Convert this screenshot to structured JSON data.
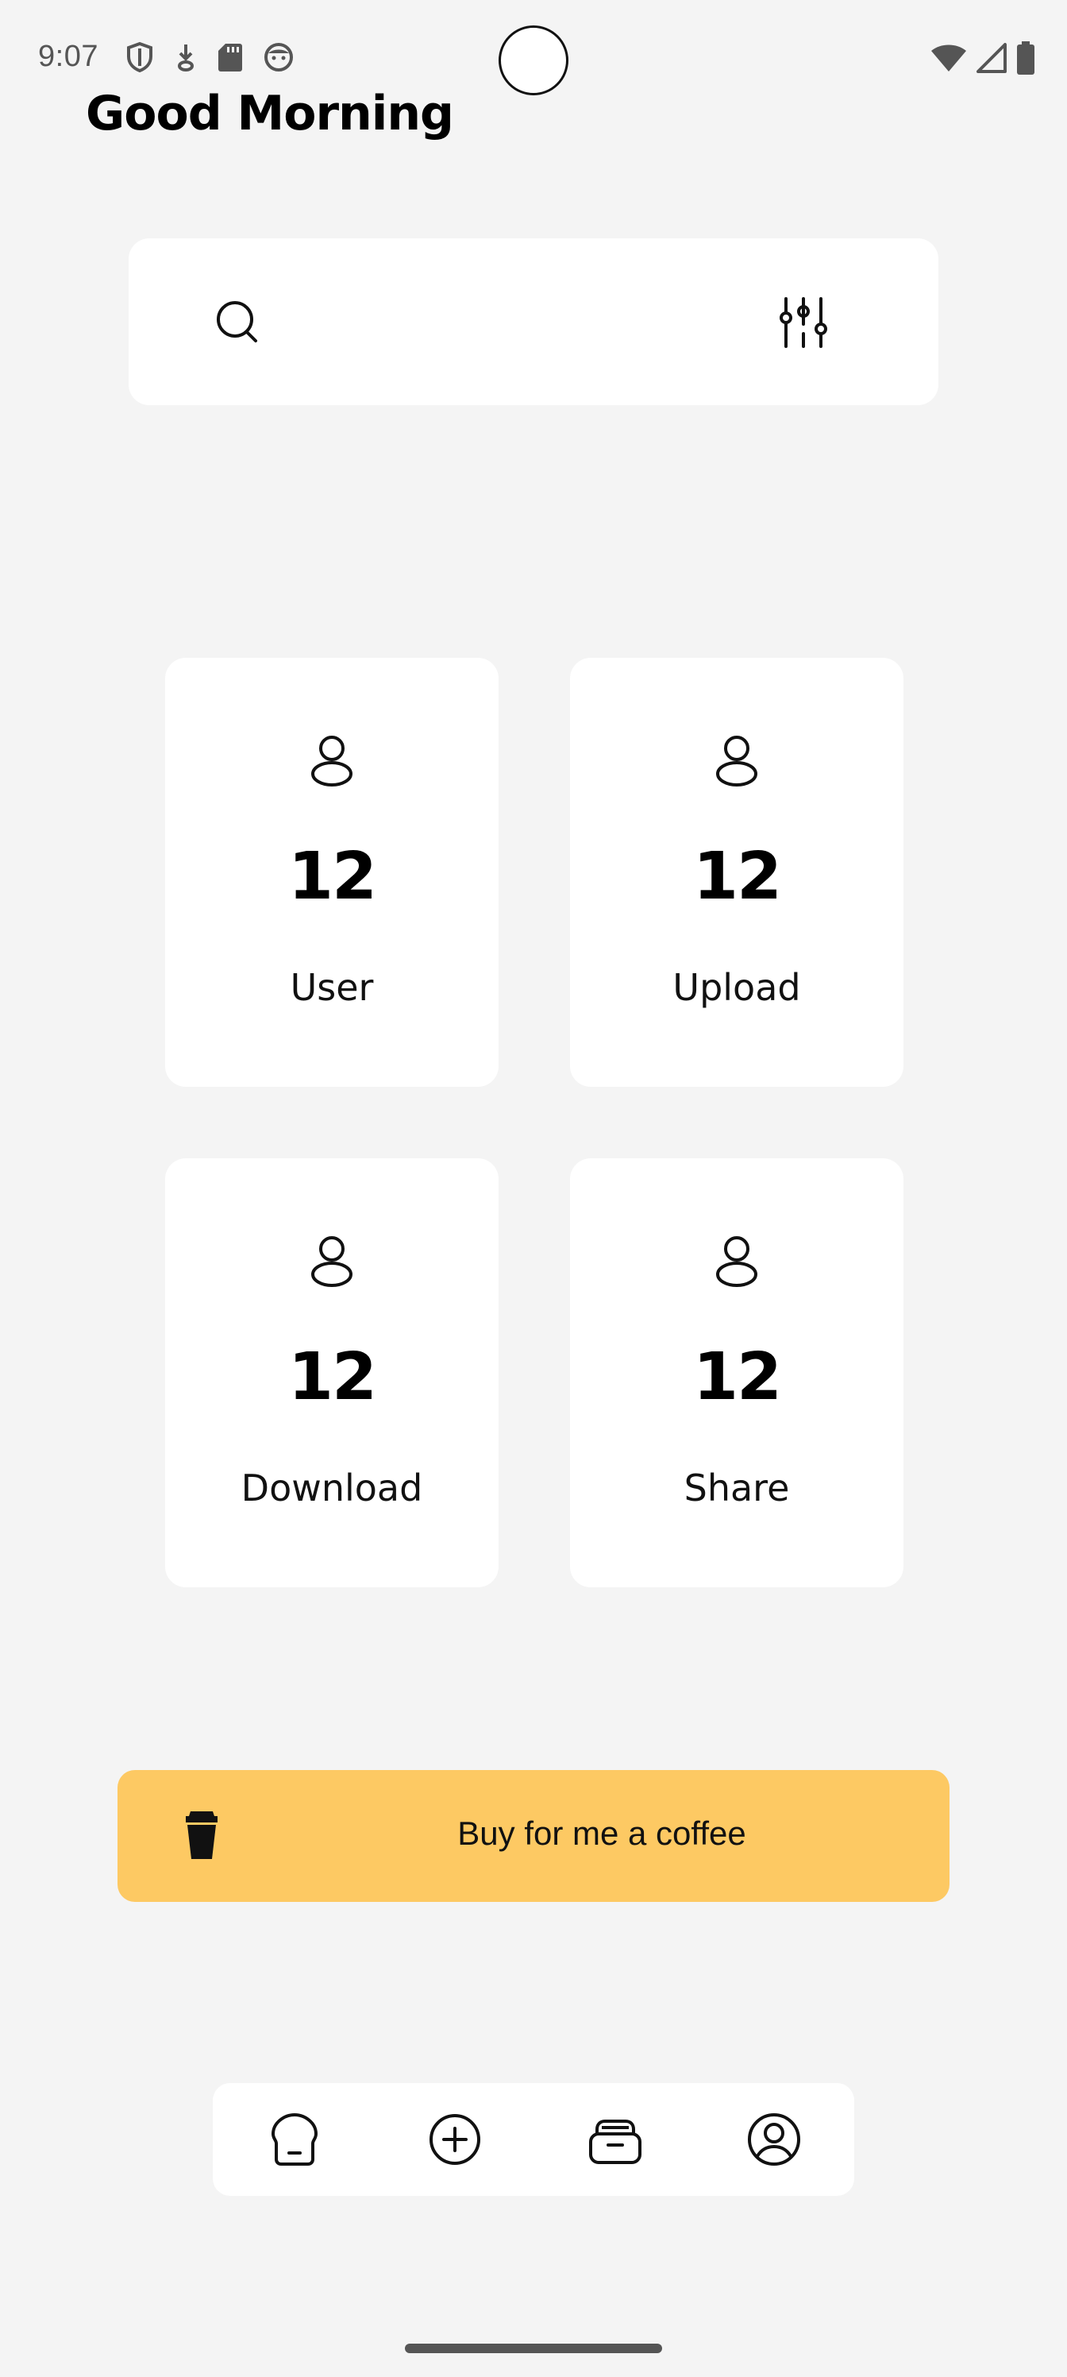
{
  "status_bar": {
    "time": "9:07",
    "left_icons": [
      "shield-icon",
      "download-arrow-icon",
      "sd-card-icon",
      "face-icon"
    ],
    "right_icons": [
      "wifi-icon",
      "signal-icon",
      "battery-icon"
    ]
  },
  "header": {
    "greeting": "Good Morning"
  },
  "search": {
    "icon": "search-icon",
    "filter_icon": "sliders-icon"
  },
  "stats": [
    {
      "icon": "user-icon",
      "value": "12",
      "label": "User"
    },
    {
      "icon": "user-icon",
      "value": "12",
      "label": "Upload"
    },
    {
      "icon": "user-icon",
      "value": "12",
      "label": "Download"
    },
    {
      "icon": "user-icon",
      "value": "12",
      "label": "Share"
    }
  ],
  "coffee": {
    "icon": "coffee-cup-icon",
    "label": "Buy for me a coffee",
    "color": "#fdc963"
  },
  "bottom_nav": {
    "items": [
      {
        "icon": "home-icon"
      },
      {
        "icon": "add-circle-icon"
      },
      {
        "icon": "archive-icon"
      },
      {
        "icon": "profile-icon"
      }
    ]
  },
  "colors": {
    "background": "#f4f4f4",
    "card": "#ffffff",
    "accent": "#fdc963"
  }
}
